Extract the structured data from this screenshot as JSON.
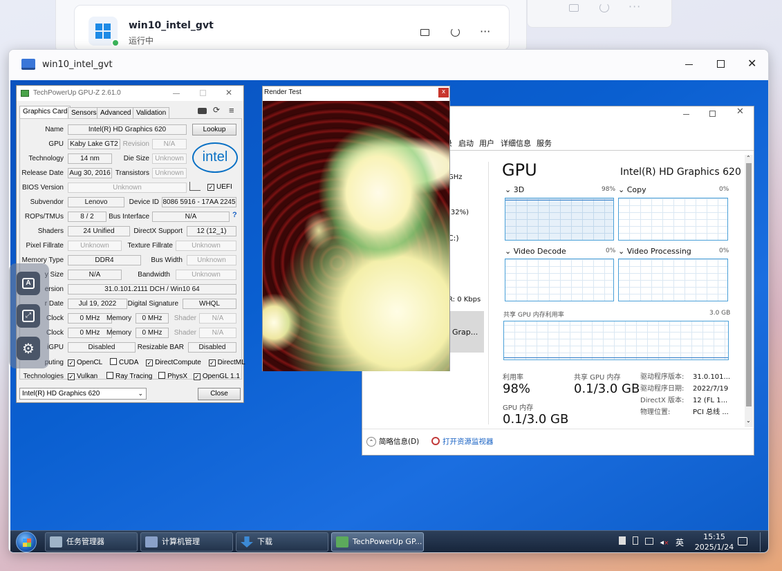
{
  "host": {
    "vm_name": "win10_intel_gvt",
    "vm_status": "运行中"
  },
  "viewer": {
    "title": "win10_intel_gvt"
  },
  "gpuz": {
    "title": "TechPowerUp GPU-Z 2.61.0",
    "tabs": [
      "Graphics Card",
      "Sensors",
      "Advanced",
      "Validation"
    ],
    "lookup": "Lookup",
    "rows": {
      "name_label": "Name",
      "name": "Intel(R) HD Graphics 620",
      "gpu_label": "GPU",
      "gpu": "Kaby Lake GT2",
      "revision_label": "Revision",
      "revision": "N/A",
      "tech_label": "Technology",
      "tech": "14 nm",
      "die_label": "Die Size",
      "die": "Unknown",
      "release_label": "Release Date",
      "release": "Aug 30, 2016",
      "trans_label": "Transistors",
      "trans": "Unknown",
      "bios_label": "BIOS Version",
      "bios": "Unknown",
      "uefi": "UEFI",
      "subvendor_label": "Subvendor",
      "subvendor": "Lenovo",
      "devid_label": "Device ID",
      "devid": "8086 5916 - 17AA 2245",
      "rops_label": "ROPs/TMUs",
      "rops": "8 / 2",
      "bus_label": "Bus Interface",
      "bus": "N/A",
      "shaders_label": "Shaders",
      "shaders": "24 Unified",
      "dx_label": "DirectX Support",
      "dx": "12 (12_1)",
      "pixel_label": "Pixel Fillrate",
      "pixel": "Unknown",
      "texture_label": "Texture Fillrate",
      "texture": "Unknown",
      "memtype_label": "Memory Type",
      "memtype": "DDR4",
      "buswidth_label": "Bus Width",
      "buswidth": "Unknown",
      "memsize_label": "y Size",
      "memsize": "N/A",
      "bandwidth_label": "Bandwidth",
      "bandwidth": "Unknown",
      "driver_label": "ersion",
      "driver": "31.0.101.2111 DCH / Win10 64",
      "driverdate_label": "r Date",
      "driverdate": "Jul 19, 2022",
      "digsig_label": "Digital Signature",
      "digsig": "WHQL",
      "clock1_label": "Clock",
      "clock1": "0 MHz",
      "mem1_label": "Memory",
      "mem1": "0 MHz",
      "shader1_label": "Shader",
      "shader1": "N/A",
      "clock2_label": "Clock",
      "clock2": "0 MHz",
      "mem2_label": "Memory",
      "mem2": "0 MHz",
      "shader2_label": "Shader",
      "shader2": "N/A",
      "mgpu_label": "iGPU",
      "mgpu": "Disabled",
      "rebar_label": "Resizable BAR",
      "rebar": "Disabled",
      "computing_label": "puting",
      "tech2_label": "Technologies"
    },
    "computing": [
      "OpenCL",
      "CUDA",
      "DirectCompute",
      "DirectML"
    ],
    "technologies": [
      "Vulkan",
      "Ray Tracing",
      "PhysX",
      "OpenGL 1.1"
    ],
    "select": "Intel(R) HD Graphics 620",
    "close": "Close"
  },
  "render": {
    "title": "Render Test",
    "close": "x"
  },
  "taskmgr": {
    "tabs": [
      "录",
      "启动",
      "用户",
      "详细信息",
      "服务"
    ],
    "left": {
      "ghz": "GHz",
      "pct": "(32%)",
      "paren": "C:)",
      "kbps": "R: 0 Kbps",
      "sel": "Grap..."
    },
    "gpu_title": "GPU",
    "gpu_name": "Intel(R) HD Graphics 620",
    "engines": [
      {
        "name": "3D",
        "pct": "98%"
      },
      {
        "name": "Copy",
        "pct": "0%"
      },
      {
        "name": "Video Decode",
        "pct": "0%"
      },
      {
        "name": "Video Processing",
        "pct": "0%"
      }
    ],
    "shared_label": "共享 GPU 内存利用率",
    "shared_max": "3.0 GB",
    "util_label": "利用率",
    "util": "98%",
    "shared_mem_label": "共享 GPU 内存",
    "shared_mem": "0.1/3.0 GB",
    "gpu_mem_label": "GPU 内存",
    "gpu_mem": "0.1/3.0 GB",
    "info": [
      {
        "k": "驱动程序版本:",
        "v": "31.0.101..."
      },
      {
        "k": "驱动程序日期:",
        "v": "2022/7/19"
      },
      {
        "k": "DirectX 版本:",
        "v": "12 (FL 1..."
      },
      {
        "k": "物理位置:",
        "v": "PCI 总线 ..."
      }
    ],
    "brief": "简略信息(D)",
    "monitor": "打开资源监视器"
  },
  "taskbar": {
    "items": [
      "任务管理器",
      "计算机管理",
      "下载",
      "TechPowerUp GP..."
    ],
    "ime": "英",
    "time": "15:15",
    "date": "2025/1/24"
  }
}
